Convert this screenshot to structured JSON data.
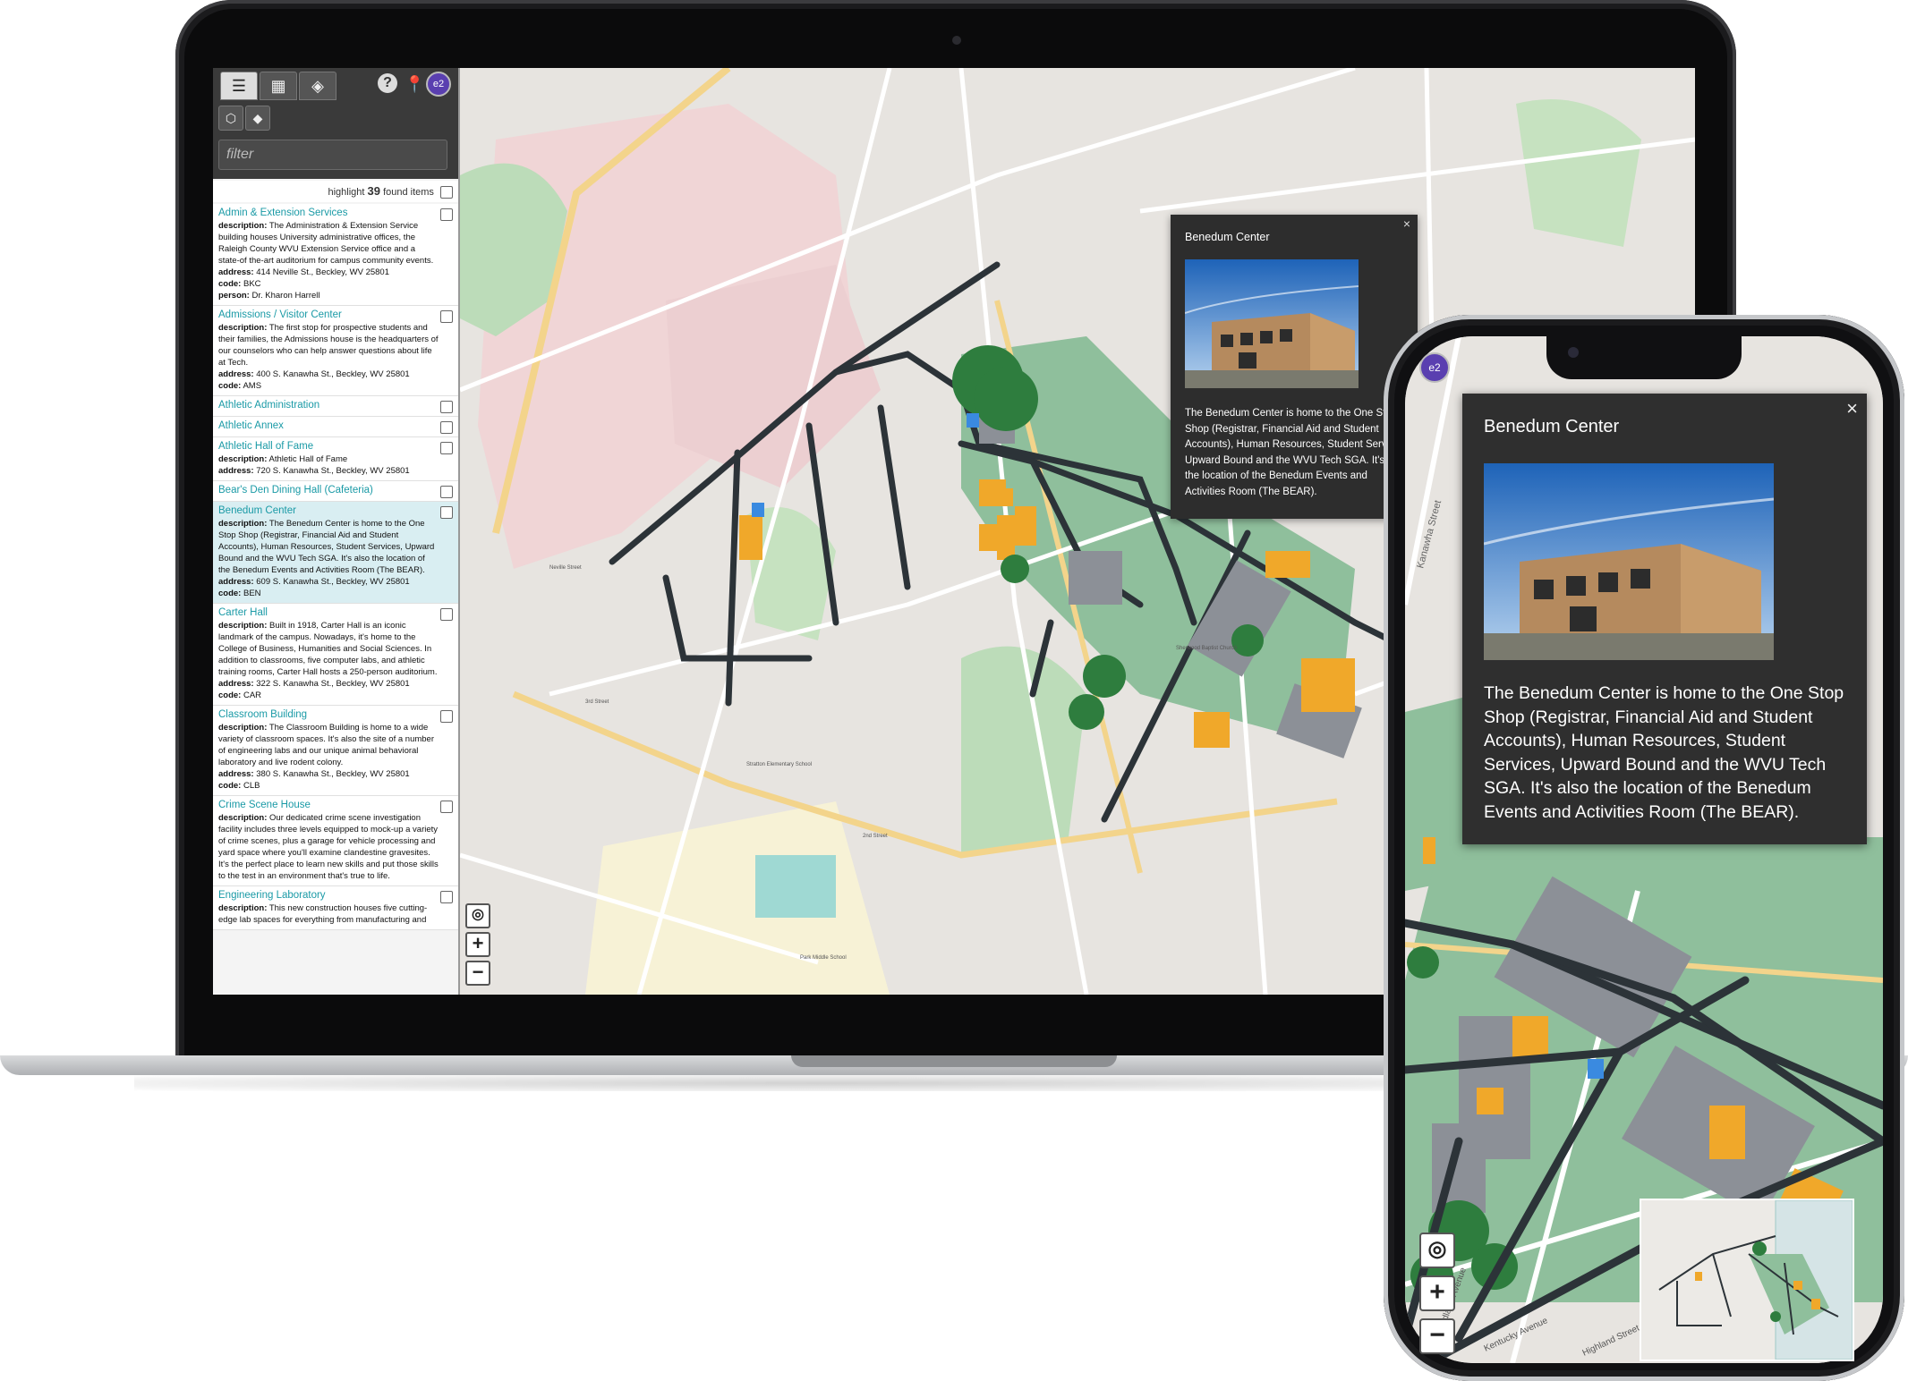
{
  "sidebar": {
    "filter_placeholder": "filter",
    "found_pre": "highlight",
    "found_count": "39",
    "found_post": "found items",
    "items": [
      {
        "name": "Admin & Extension Services",
        "lines": [
          {
            "k": "description:",
            "v": "The Administration & Extension Service building houses University administrative offices, the Raleigh County WVU Extension Service office and a state-of the-art auditorium for campus community events."
          },
          {
            "k": "address:",
            "v": "414 Neville St., Beckley, WV 25801"
          },
          {
            "k": "code:",
            "v": "BKC"
          },
          {
            "k": "person:",
            "v": "Dr. Kharon Harrell"
          }
        ]
      },
      {
        "name": "Admissions / Visitor Center",
        "lines": [
          {
            "k": "description:",
            "v": "The first stop for prospective students and their families, the Admissions house is the headquarters of our counselors who can help answer questions about life at Tech."
          },
          {
            "k": "address:",
            "v": "400 S. Kanawha St., Beckley, WV 25801"
          },
          {
            "k": "code:",
            "v": "AMS"
          }
        ]
      },
      {
        "name": "Athletic Administration",
        "lines": []
      },
      {
        "name": "Athletic Annex",
        "lines": []
      },
      {
        "name": "Athletic Hall of Fame",
        "lines": [
          {
            "k": "description:",
            "v": "Athletic Hall of Fame"
          },
          {
            "k": "address:",
            "v": "720 S. Kanawha St., Beckley, WV 25801"
          }
        ]
      },
      {
        "name": "Bear's Den Dining Hall (Cafeteria)",
        "lines": []
      },
      {
        "name": "Benedum Center",
        "selected": true,
        "lines": [
          {
            "k": "description:",
            "v": "The Benedum Center is home to the One Stop Shop (Registrar, Financial Aid and Student Accounts), Human Resources, Student Services, Upward Bound and the WVU Tech SGA. It's also the location of the Benedum Events and Activities Room (The BEAR)."
          },
          {
            "k": "address:",
            "v": "609 S. Kanawha St., Beckley, WV 25801"
          },
          {
            "k": "code:",
            "v": "BEN"
          }
        ]
      },
      {
        "name": "Carter Hall",
        "lines": [
          {
            "k": "description:",
            "v": "Built in 1918, Carter Hall is an iconic landmark of the campus. Nowadays, it's home to the College of Business, Humanities and Social Sciences. In addition to classrooms, five computer labs, and athletic training rooms, Carter Hall hosts a 250-person auditorium."
          },
          {
            "k": "address:",
            "v": "322 S. Kanawha St., Beckley, WV 25801"
          },
          {
            "k": "code:",
            "v": "CAR"
          }
        ]
      },
      {
        "name": "Classroom Building",
        "lines": [
          {
            "k": "description:",
            "v": "The Classroom Building is home to a wide variety of classroom spaces. It's also the site of a number of engineering labs and our unique animal behavioral laboratory and live rodent colony."
          },
          {
            "k": "address:",
            "v": "380 S. Kanawha St., Beckley, WV 25801"
          },
          {
            "k": "code:",
            "v": "CLB"
          }
        ]
      },
      {
        "name": "Crime Scene House",
        "lines": [
          {
            "k": "description:",
            "v": "Our dedicated crime scene investigation facility includes three levels equipped to mock-up a variety of crime scenes, plus a garage for vehicle processing and yard space where you'll examine clandestine gravesites. It's the perfect place to learn new skills and put those skills to the test in an environment that's true to life."
          }
        ]
      },
      {
        "name": "Engineering Laboratory",
        "lines": [
          {
            "k": "description:",
            "v": "This new construction houses five cutting-edge lab spaces for everything from manufacturing and"
          }
        ]
      }
    ]
  },
  "popup": {
    "title": "Benedum Center",
    "text": "The Benedum Center is home to the One Stop Shop (Registrar, Financial Aid and Student Accounts), Human Resources, Student Services, Upward Bound and the WVU Tech SGA. It's also the location of the Benedum Events and Activities Room (The BEAR).",
    "close": "×"
  },
  "map_labels": {
    "school": "Stratton Elementary School",
    "park": "Park Middle School",
    "church": "Sherwood Baptist Church",
    "st1": "2nd Street",
    "st2": "3rd Street",
    "st3": "Neville Street",
    "st4": "Kentucky Avenue",
    "st5": "Highland Street",
    "st6": "Kanawha Street",
    "st7": "Woodlawn Avenue"
  },
  "controls": {
    "locate": "◎",
    "zoom_in": "+",
    "zoom_out": "−"
  },
  "icons": {
    "list": "list-icon",
    "map": "map-icon",
    "directions": "directions-icon",
    "tag": "tag-icon",
    "layers": "layers-icon",
    "help": "help-icon",
    "pin": "pin-icon",
    "logo": "logo-icon"
  },
  "colors": {
    "sidebar_dark": "#3a3a3a",
    "link": "#1a9aa6",
    "building": "#f0a82a",
    "campus": "#8fbf9c",
    "road": "#2c3338",
    "parking": "#8c9097",
    "tree": "#2e7d3e"
  }
}
